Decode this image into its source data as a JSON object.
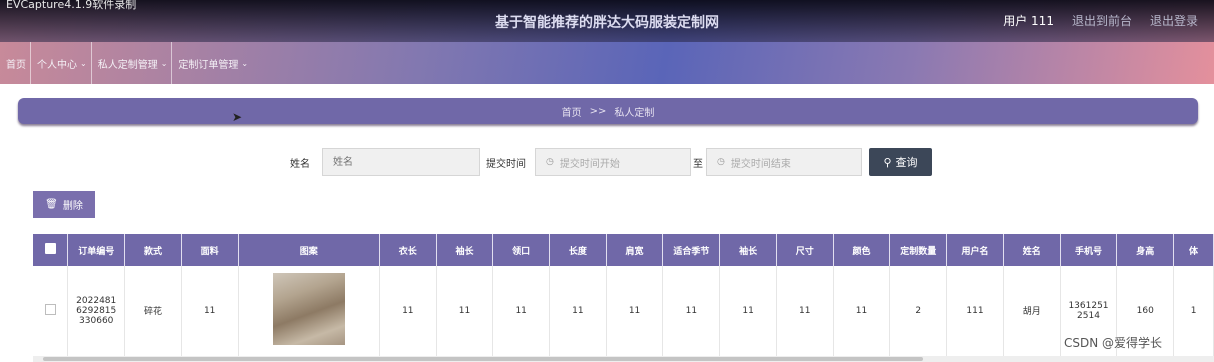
{
  "recording_label": "EVCapture4.1.9软件录制",
  "site_title": "基于智能推荐的胖达大码服装定制网",
  "user": {
    "name": "用户 111",
    "backend_link": "退出到前台",
    "logout_link": "退出登录"
  },
  "nav": {
    "home": "首页",
    "personal_center": "个人中心",
    "private_custom_manage": "私人定制管理",
    "order_manage": "定制订单管理"
  },
  "breadcrumb": {
    "home": "首页",
    "separator": ">>",
    "current": "私人定制"
  },
  "search": {
    "name_label": "姓名",
    "name_placeholder": "姓名",
    "time_label": "提交时间",
    "start_placeholder": "提交时间开始",
    "to_label": "至",
    "end_placeholder": "提交时间结束",
    "button": "查询"
  },
  "delete_button": "删除",
  "table": {
    "columns": [
      "订单编号",
      "款式",
      "面料",
      "图案",
      "衣长",
      "袖长",
      "领口",
      "长度",
      "肩宽",
      "适合季节",
      "袖长",
      "尺寸",
      "颜色",
      "定制数量",
      "用户名",
      "姓名",
      "手机号",
      "身高",
      "体"
    ],
    "rows": [
      {
        "order_no": "2022481 6292815 330660",
        "style": "碎花",
        "fabric": "11",
        "pattern_image": "dress-photo",
        "clothing_length": "11",
        "sleeve_length": "11",
        "collar": "11",
        "length": "11",
        "shoulder": "11",
        "season": "11",
        "sleeve_length2": "11",
        "size": "11",
        "color": "11",
        "quantity": "2",
        "username": "111",
        "name": "胡月",
        "phone": "1361251 2514",
        "height": "160",
        "weight": "1"
      }
    ]
  },
  "watermark": "CSDN @爱得学长",
  "icons": {
    "search": "search-icon",
    "delete": "trash-icon",
    "clock": "clock-icon",
    "chevron": "chevron-down-icon"
  },
  "colors": {
    "primary": "#7068a8",
    "search_button": "#3c4758"
  }
}
